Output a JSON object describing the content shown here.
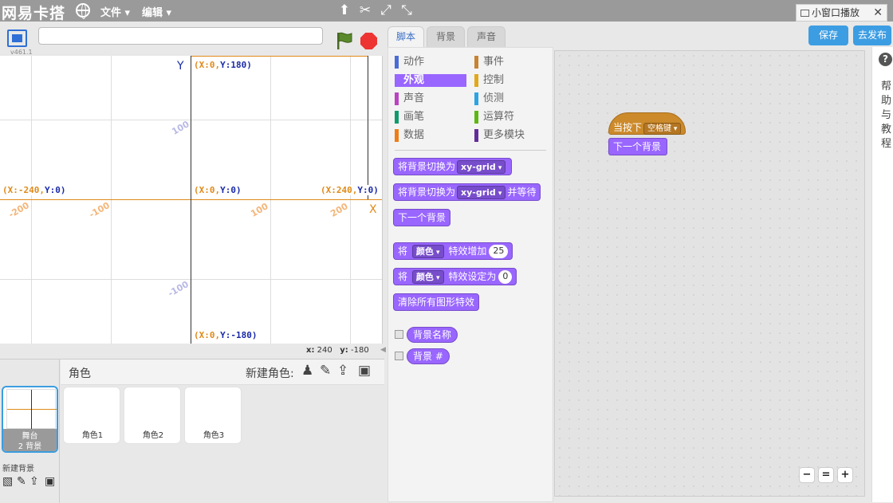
{
  "menubar": {
    "brand": "网易卡搭",
    "file_menu": "文件",
    "edit_menu": "编辑",
    "mini_play": "小窗口播放"
  },
  "stage": {
    "version": "v461.1",
    "coords": {
      "top": [
        "(X:0,",
        "Y:180)"
      ],
      "left": [
        "(X:-240,",
        "Y:0)"
      ],
      "center": [
        "(X:0,",
        "Y:0)"
      ],
      "right": [
        "(X:240,",
        "Y:0)"
      ],
      "bottom": [
        "(X:0,",
        "Y:-180)"
      ]
    },
    "axis_y": "Y",
    "axis_x": "X",
    "x_ticks": [
      "-200",
      "-100",
      "100",
      "200"
    ],
    "y_ticks": [
      "100",
      "-100"
    ],
    "mouse_x_label": "x:",
    "mouse_x": "240",
    "mouse_y_label": "y:",
    "mouse_y": "-180"
  },
  "sprites": {
    "header": "角色",
    "new_sprite": "新建角色:",
    "stage_label": "舞台",
    "stage_count": "2 背景",
    "new_backdrop": "新建背景",
    "items": [
      "角色1",
      "角色2",
      "角色3"
    ]
  },
  "tabs": [
    "脚本",
    "背景",
    "声音"
  ],
  "categories": [
    {
      "label": "动作",
      "color": "#4a6cd4"
    },
    {
      "label": "事件",
      "color": "#c88330"
    },
    {
      "label": "外观",
      "color": "#9966ff"
    },
    {
      "label": "控制",
      "color": "#e1a91a"
    },
    {
      "label": "声音",
      "color": "#bb42c3"
    },
    {
      "label": "侦测",
      "color": "#2ca5e2"
    },
    {
      "label": "画笔",
      "color": "#0e9a6c"
    },
    {
      "label": "运算符",
      "color": "#5cb712"
    },
    {
      "label": "数据",
      "color": "#ee7d16"
    },
    {
      "label": "更多模块",
      "color": "#632d99"
    }
  ],
  "blocks": {
    "b1_text": "将背景切换为",
    "b1_dd": "xy-grid",
    "b2_text": "将背景切换为",
    "b2_dd": "xy-grid",
    "b2_tail": "并等待",
    "b3_text": "下一个背景",
    "b4_text": "将",
    "b4_dd": "颜色",
    "b4_mid": "特效增加",
    "b4_num": "25",
    "b5_text": "将",
    "b5_dd": "颜色",
    "b5_mid": "特效设定为",
    "b5_num": "0",
    "b6_text": "清除所有图形特效",
    "r1_text": "背景名称",
    "r2_text": "背景 #"
  },
  "script": {
    "hat_text": "当按下",
    "hat_key": "空格键",
    "block_text": "下一个背景"
  },
  "buttons": {
    "save": "保存",
    "share": "去发布"
  },
  "help": {
    "icon": "?",
    "text": "帮助与教程"
  }
}
